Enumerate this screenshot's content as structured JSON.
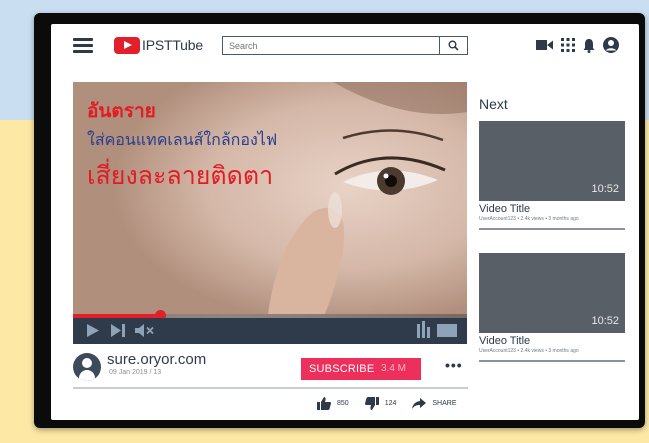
{
  "header": {
    "logo_text": "IPSTTube",
    "search_placeholder": "Search",
    "icons": [
      "menu-icon",
      "youtube-logo-icon",
      "search-icon",
      "video-camera-icon",
      "apps-grid-icon",
      "bell-icon",
      "account-icon"
    ]
  },
  "video": {
    "overlay_line1": "อันตราย",
    "overlay_line2": "ใส่คอนแทคเลนส์ใกล้กองไฟ",
    "overlay_line3": "เสี่ยงละลายติดตา",
    "progress": 0.22
  },
  "channel": {
    "name": "sure.oryor.com",
    "date": "09 Jan 2019 / 13"
  },
  "subscribe": {
    "label": "SUBSCRIBE",
    "count": "3.4 M"
  },
  "more_label": "•••",
  "stats": {
    "likes": "850",
    "dislikes": "124",
    "share_label": "SHARE"
  },
  "sidebar": {
    "heading": "Next",
    "items": [
      {
        "duration": "10:52",
        "title": "Video Title",
        "meta": "UserAccount123 • 2.4k views • 3 months ago"
      },
      {
        "duration": "10:52",
        "title": "Video Title",
        "meta": "UserAccount123 • 2.4k views • 3 months ago"
      }
    ]
  },
  "colors": {
    "brand_red": "#e2202b",
    "subscribe_pink": "#ec2f5b",
    "ui_navy": "#2d3a4a",
    "background_blue": "#c9def0",
    "background_yellow": "#fde8a6"
  }
}
